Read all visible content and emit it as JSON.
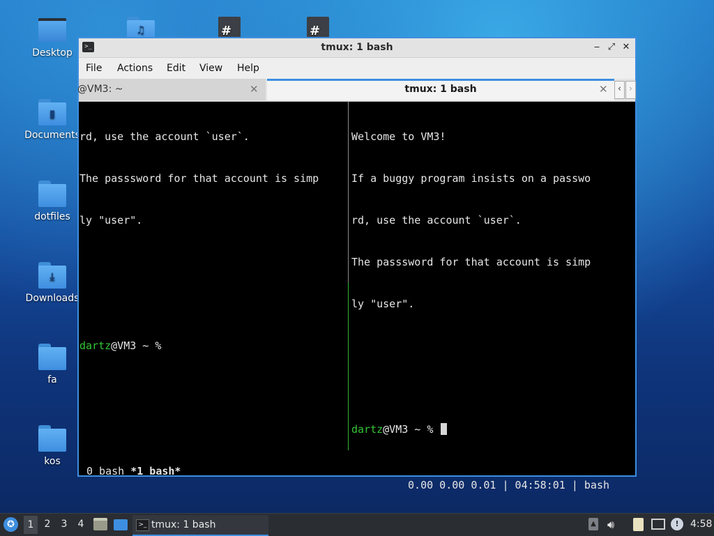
{
  "desktop": {
    "icons": [
      {
        "label": "Desktop",
        "icon": "monitor-icon"
      },
      {
        "label": "",
        "icon": "music-folder-icon"
      },
      {
        "label": "",
        "icon": "text-file-icon"
      },
      {
        "label": "",
        "icon": "text-file-icon"
      },
      {
        "label": "Documents",
        "icon": "documents-folder-icon"
      },
      {
        "label": "dotfiles",
        "icon": "folder-icon"
      },
      {
        "label": "Downloads",
        "icon": "downloads-folder-icon"
      },
      {
        "label": "fa",
        "icon": "folder-icon"
      },
      {
        "label": "kos",
        "icon": "folder-icon"
      }
    ]
  },
  "window": {
    "title": "tmux: 1 bash",
    "controls": {
      "minimize": "‒",
      "maximize": "⤢",
      "close": "✕"
    },
    "menu": [
      "File",
      "Actions",
      "Edit",
      "View",
      "Help"
    ],
    "tabs": [
      {
        "label": "@VM3: ~",
        "close": "✕",
        "active": false
      },
      {
        "label": "tmux: 1 bash",
        "close": "✕",
        "active": true
      }
    ],
    "tab_nav": {
      "prev": "‹",
      "next": "›"
    }
  },
  "terminal": {
    "left_pane": {
      "lines": [
        "rd, use the account `user`.",
        "The passsword for that account is simp",
        "ly \"user\".",
        ""
      ],
      "prompt_user": "dartz",
      "prompt_rest": "@VM3 ~ %"
    },
    "right_pane": {
      "lines": [
        "Welcome to VM3!",
        "If a buggy program insists on a passwo",
        "rd, use the account `user`.",
        "The passsword for that account is simp",
        "ly \"user\".",
        ""
      ],
      "prompt_user": "dartz",
      "prompt_rest": "@VM3 ~ %"
    },
    "status": {
      "window0": "0 bash",
      "window1": "*1 bash*",
      "right": "0.00 0.00 0.01 | 04:58:01 | bash"
    }
  },
  "taskbar": {
    "workspaces": [
      "1",
      "2",
      "3",
      "4"
    ],
    "active_workspace": "1",
    "task_label": "tmux: 1 bash",
    "clock": "4:58"
  },
  "colors": {
    "accent": "#3d8ee0",
    "prompt_green": "#35c435"
  }
}
